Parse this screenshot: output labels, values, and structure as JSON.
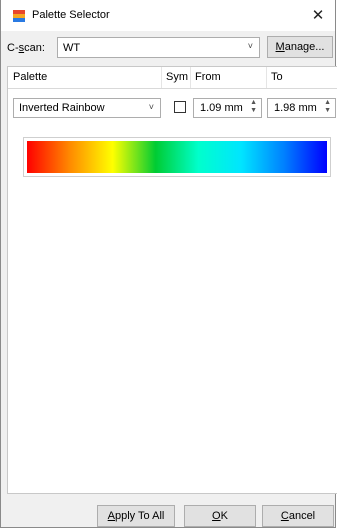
{
  "window": {
    "title": "Palette Selector",
    "close_glyph": "✕",
    "icon": "palette-app-icon"
  },
  "scan": {
    "label_prefix": "C-",
    "label_hotkey": "s",
    "label_suffix": "can:",
    "value": "WT",
    "chevron": "˅"
  },
  "manage_button": {
    "hotkey": "M",
    "rest": "anage..."
  },
  "grid": {
    "columns": [
      "Palette",
      "Sym",
      "From",
      "To"
    ],
    "rows": [
      {
        "palette": "Inverted Rainbow",
        "sym_checked": false,
        "from": "1.09 mm",
        "to": "1.98 mm"
      }
    ]
  },
  "colors": {
    "gradient": [
      "#ff0000",
      "#ff8a00",
      "#ffff00",
      "#00cc33",
      "#00ffcc",
      "#00e5ff",
      "#0080ff",
      "#0000ff"
    ]
  },
  "footer": {
    "apply_hotkey": "A",
    "apply_rest": "pply To All",
    "ok_hotkey": "O",
    "ok_rest": "K",
    "cancel_hotkey": "C",
    "cancel_rest": "ancel"
  }
}
